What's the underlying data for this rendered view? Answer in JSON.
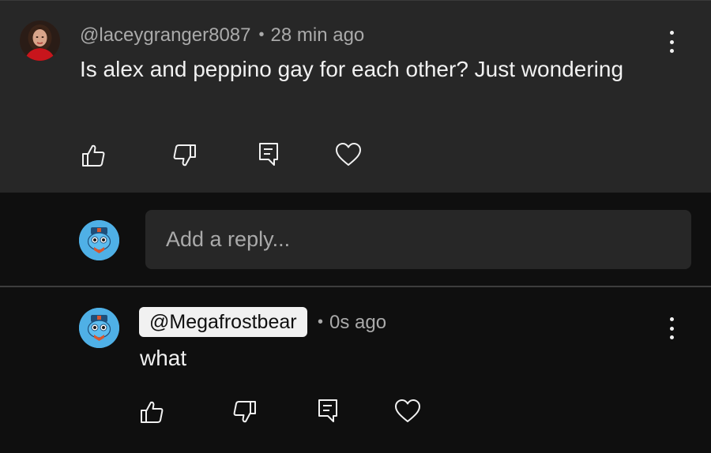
{
  "parent_comment": {
    "author": "@laceygranger8087",
    "separator": "•",
    "time": "28 min ago",
    "text": "Is alex and peppino gay for each other? Just wondering",
    "avatar_icon": "user-avatar-photo",
    "actions": [
      "like-icon",
      "dislike-icon",
      "reply-icon",
      "heart-icon"
    ],
    "menu_icon": "more-vertical-icon"
  },
  "reply_box": {
    "placeholder": "Add a reply...",
    "avatar_icon": "self-avatar-robot"
  },
  "user_reply": {
    "author": "@Megafrostbear",
    "separator": "•",
    "time": "0s ago",
    "text": "what",
    "avatar_icon": "self-avatar-robot",
    "actions": [
      "like-icon",
      "dislike-icon",
      "reply-icon",
      "heart-icon"
    ],
    "menu_icon": "more-vertical-icon"
  },
  "colors": {
    "background": "#0f0f0f",
    "card": "#272727",
    "text_primary": "#f1f1f1",
    "text_secondary": "#aaaaaa",
    "avatar_blue": "#4fb0e6"
  }
}
